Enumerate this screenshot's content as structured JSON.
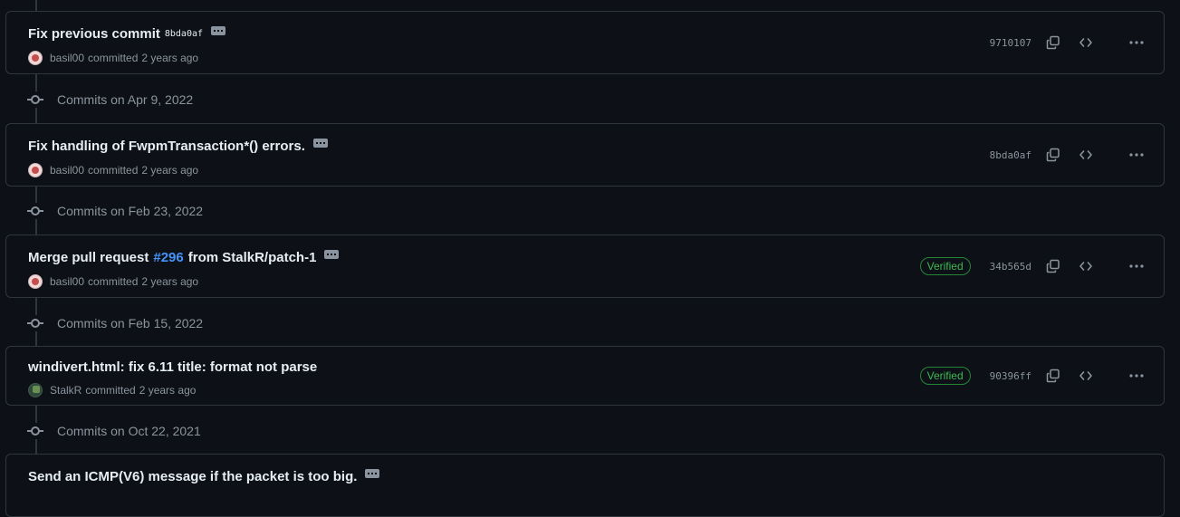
{
  "groups": [
    {
      "label": "Commits on Apr 9, 2022"
    },
    {
      "label": "Commits on Feb 23, 2022"
    },
    {
      "label": "Commits on Feb 15, 2022"
    },
    {
      "label": "Commits on Oct 22, 2021"
    }
  ],
  "commits": [
    {
      "title": "Fix previous commit",
      "inline_sha": "8bda0af",
      "author": "basil00",
      "committed": "committed",
      "time": "2 years ago",
      "sha": "9710107"
    },
    {
      "title": "Fix handling of FwpmTransaction*() errors.",
      "author": "basil00",
      "committed": "committed",
      "time": "2 years ago",
      "sha": "8bda0af"
    },
    {
      "title_prefix": "Merge pull request",
      "issue": "#296",
      "title_suffix": "from StalkR/patch-1",
      "author": "basil00",
      "committed": "committed",
      "time": "2 years ago",
      "verified": "Verified",
      "sha": "34b565d"
    },
    {
      "title": "windivert.html: fix 6.11 title: format not parse",
      "author": "StalkR",
      "committed": "committed",
      "time": "2 years ago",
      "verified": "Verified",
      "sha": "90396ff"
    },
    {
      "title": "Send an ICMP(V6) message if the packet is too big."
    }
  ],
  "icons": {
    "copy": "copy-icon",
    "browse": "code-icon",
    "more": "kebab-horizontal-icon",
    "ellipsis": "ellipsis-icon",
    "commit_node": "git-commit-icon"
  }
}
